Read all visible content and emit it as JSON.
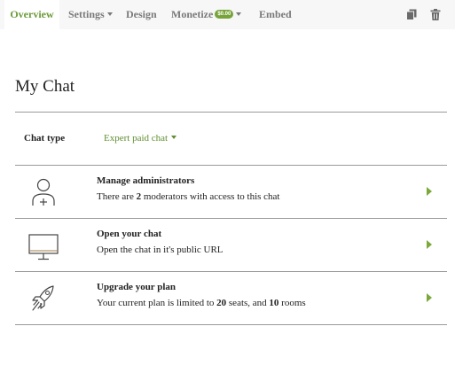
{
  "tabs": [
    {
      "label": "Overview",
      "active": true
    },
    {
      "label": "Settings",
      "dropdown": true
    },
    {
      "label": "Design"
    },
    {
      "label": "Monetize",
      "dropdown": true,
      "badge": "$0.00"
    },
    {
      "label": "Embed"
    }
  ],
  "toolbar": {
    "copy_icon": "copy-icon",
    "delete_icon": "trash-icon"
  },
  "page": {
    "title": "My Chat"
  },
  "chat_type": {
    "label": "Chat type",
    "value": "Expert paid chat"
  },
  "rows": [
    {
      "icon": "user-add-icon",
      "title": "Manage administrators",
      "desc_parts": [
        "There are ",
        "2",
        " moderators with access to this chat"
      ]
    },
    {
      "icon": "monitor-icon",
      "title": "Open your chat",
      "desc_parts": [
        "Open the chat in it's public URL"
      ]
    },
    {
      "icon": "rocket-icon",
      "title": "Upgrade your plan",
      "desc_parts": [
        "Your current plan is limited to ",
        "20",
        " seats, and ",
        "10",
        " rooms"
      ]
    }
  ],
  "colors": {
    "accent": "#77a33a",
    "text": "#222222",
    "tab_inactive": "#7a7a7a",
    "topbar_bg": "#f7f7f7"
  }
}
